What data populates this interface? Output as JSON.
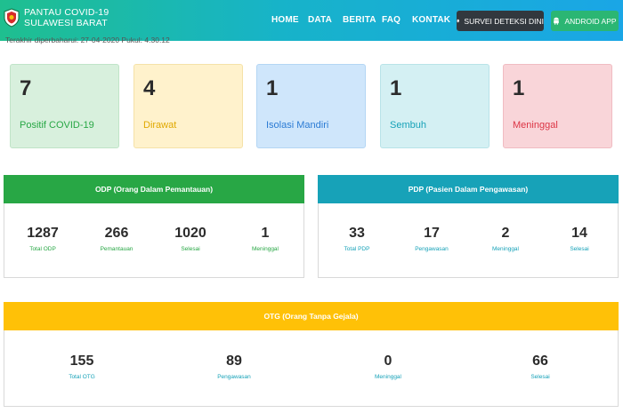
{
  "brand": {
    "line1": "PANTAU COVID-19",
    "line2": "SULAWESI BARAT"
  },
  "nav": [
    {
      "label": "HOME"
    },
    {
      "label": "DATA"
    },
    {
      "label": "BERITA"
    },
    {
      "label": "FAQ"
    },
    {
      "label": "KONTAK"
    }
  ],
  "buttons": {
    "survei": "SURVEI DETEKSI DINI",
    "android": "ANDROID APP"
  },
  "updated": "Terakhir diperbaharui: 27-04-2020 Pukul: 4.30.12",
  "summary": [
    {
      "value": "7",
      "label": "Positif COVID-19"
    },
    {
      "value": "4",
      "label": "Dirawat"
    },
    {
      "value": "1",
      "label": "Isolasi Mandiri"
    },
    {
      "value": "1",
      "label": "Sembuh"
    },
    {
      "value": "1",
      "label": "Meninggal"
    }
  ],
  "odp": {
    "title": "ODP (Orang Dalam Pemantauan)",
    "stats": [
      {
        "value": "1287",
        "label": "Total ODP"
      },
      {
        "value": "266",
        "label": "Pemantauan"
      },
      {
        "value": "1020",
        "label": "Selesai"
      },
      {
        "value": "1",
        "label": "Meninggal"
      }
    ]
  },
  "pdp": {
    "title": "PDP (Pasien Dalam Pengawasan)",
    "stats": [
      {
        "value": "33",
        "label": "Total PDP"
      },
      {
        "value": "17",
        "label": "Pengawasan"
      },
      {
        "value": "2",
        "label": "Meninggal"
      },
      {
        "value": "14",
        "label": "Selesai"
      }
    ]
  },
  "otg": {
    "title": "OTG (Orang Tanpa Gejala)",
    "stats": [
      {
        "value": "155",
        "label": "Total OTG"
      },
      {
        "value": "89",
        "label": "Pengawasan"
      },
      {
        "value": "0",
        "label": "Meninggal"
      },
      {
        "value": "66",
        "label": "Selesai"
      }
    ]
  },
  "icons": {
    "logo": "province-shield-icon",
    "survei": "bell-icon",
    "android": "android-icon"
  }
}
